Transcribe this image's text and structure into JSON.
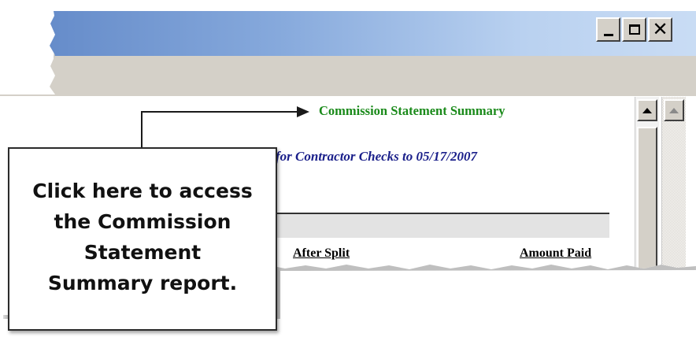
{
  "window": {
    "controls": {
      "minimize_icon": "minimize-icon",
      "maximize_icon": "maximize-icon",
      "close_glyph": "✕",
      "close_icon": "close-icon"
    },
    "colors": {
      "titlebar_start": "#5f86c6",
      "titlebar_end": "#c9dcf4",
      "chrome": "#d4d0c8"
    }
  },
  "report": {
    "title": "Commission Statement Summary",
    "subtitle": "for Contractor Checks to 05/17/2007",
    "columns": {
      "after_split": "After Split",
      "amount_paid": "Amount Paid"
    },
    "colors": {
      "title": "#1a8a1a",
      "subtitle": "#1a1f8a"
    }
  },
  "callout": {
    "lines": [
      "Click here to access",
      "the Commission",
      "Statement",
      "Summary report."
    ]
  },
  "scrollbar": {
    "up_icon": "scroll-up-arrow-icon"
  }
}
